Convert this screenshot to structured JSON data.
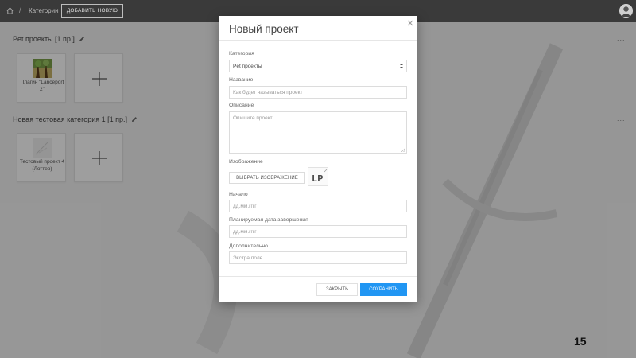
{
  "topbar": {
    "breadcrumb_separator": "/",
    "breadcrumb_current": "Категории",
    "add_new_label": "ДОБАВИТЬ НОВУЮ"
  },
  "categories": [
    {
      "title": "Pet проекты [1 пр.]",
      "cards": [
        {
          "label": "Плагин \"Lanceport 2\""
        }
      ]
    },
    {
      "title": "Новая тестовая категория 1 [1 пр.]",
      "cards": [
        {
          "label": "Тестовый проект 4 (Лоттер)"
        }
      ]
    }
  ],
  "more_dots": "...",
  "modal": {
    "title": "Новый проект",
    "category_label": "Категория",
    "category_value": "Pet проекты",
    "name_label": "Название",
    "name_placeholder": "Как будет называться проект",
    "description_label": "Описание",
    "description_placeholder": "Опишите проект",
    "image_label": "Изображение",
    "choose_image_label": "ВЫБРАТЬ ИЗОБРАЖЕНИЕ",
    "image_preview_text": "LP",
    "start_label": "Начало",
    "start_placeholder": "дд.мм.гггг",
    "end_label": "Планируемая дата завершения",
    "end_placeholder": "дд.мм.гггг",
    "extra_label": "Дополнительно",
    "extra_placeholder": "Экстра поле",
    "close_label": "ЗАКРЫТЬ",
    "save_label": "СОХРАНИТЬ"
  },
  "slide_number": "15",
  "colors": {
    "topbar": "#3a3a3a",
    "primary": "#2196f3",
    "overlay": "rgba(0,0,0,0.38)"
  }
}
